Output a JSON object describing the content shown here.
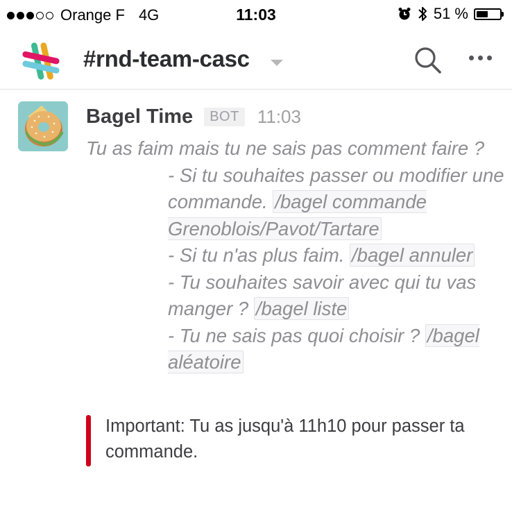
{
  "status_bar": {
    "carrier": "Orange F",
    "network": "4G",
    "time": "11:03",
    "battery_pct": "51 %",
    "battery_level": 0.51,
    "signal_bars_filled": 3,
    "signal_bars_total": 5
  },
  "header": {
    "channel_name": "#rnd-team-casc"
  },
  "message": {
    "sender": "Bagel Time",
    "badge": "BOT",
    "time": "11:03",
    "intro": "Tu as faim mais tu ne sais pas comment faire ?",
    "line1_text": "- Si tu souhaites passer ou modifier une commande.",
    "line1_cmd": "/bagel commande Grenoblois/Pavot/Tartare",
    "line2_text": "- Si tu n'as plus faim.",
    "line2_cmd": "/bagel annuler",
    "line3_text": "- Tu souhaites savoir avec qui tu vas manger ?",
    "line3_cmd": "/bagel liste",
    "line4_text": "- Tu ne sais pas quoi choisir ?",
    "line4_cmd": "/bagel aléatoire"
  },
  "attachment": {
    "text": "Important: Tu as jusqu'à 11h10 pour passer ta commande.",
    "color": "#d0021b"
  }
}
